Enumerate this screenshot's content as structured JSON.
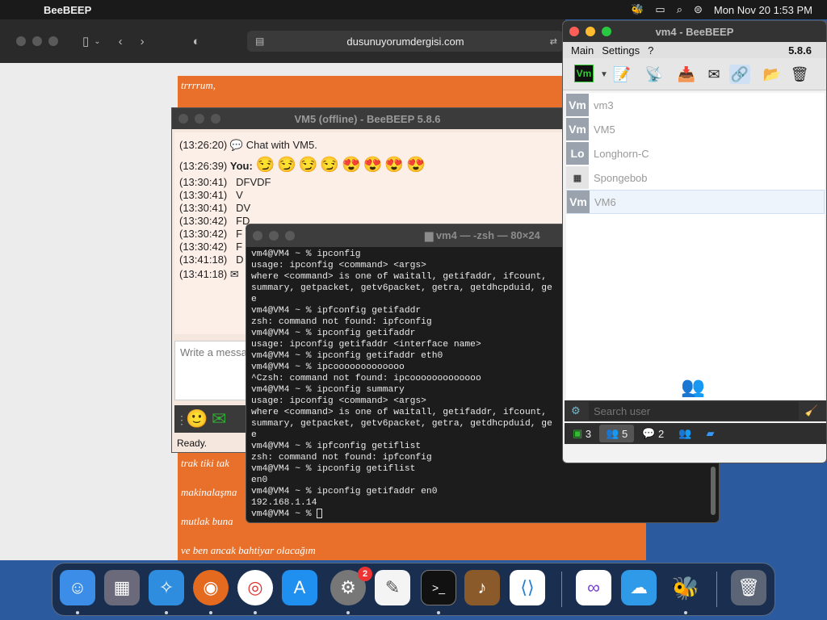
{
  "menubar": {
    "app": "BeeBEEP",
    "datetime": "Mon Nov 20  1:53 PM"
  },
  "safari": {
    "url": "dusunuyorumdergisi.com"
  },
  "article": {
    "lines": [
      "trrrrum,",
      "trak tiki tak",
      "makinalaşma",
      "mutlak buna",
      "ve ben ancak bahtiyar olacağım"
    ]
  },
  "vm5": {
    "title": "VM5 (offline) - BeeBEEP 5.8.6",
    "chat": [
      {
        "time": "(13:26:20)",
        "text": "Chat with VM5."
      },
      {
        "time": "(13:26:39)",
        "text": "You:"
      },
      {
        "time": "(13:30:41)",
        "text": "DFVDF"
      },
      {
        "time": "(13:30:41)",
        "text": "V"
      },
      {
        "time": "(13:30:41)",
        "text": "DV"
      },
      {
        "time": "(13:30:42)",
        "text": "FD"
      },
      {
        "time": "(13:30:42)",
        "text": "F"
      },
      {
        "time": "(13:30:42)",
        "text": "F"
      },
      {
        "time": "(13:41:18)",
        "text": "D"
      },
      {
        "time": "(13:41:18)",
        "text": ""
      }
    ],
    "emojis": "😏😏😏😏😍😍😍😍",
    "input_placeholder": "Write a message",
    "status": "Ready."
  },
  "terminal": {
    "title": "vm4 — -zsh — 80×24",
    "lines": [
      "vm4@VM4 ~ % ipconfig",
      "usage: ipconfig <command> <args>",
      "where <command> is one of waitall, getifaddr, ifcount,",
      "summary, getpacket, getv6packet, getra, getdhcpduid, ge",
      "e",
      "vm4@VM4 ~ % ipfconfig getifaddr",
      "zsh: command not found: ipfconfig",
      "vm4@VM4 ~ % ipconfig getifaddr",
      "usage: ipconfig getifaddr <interface name>",
      "vm4@VM4 ~ % ipconfig getifaddr eth0",
      "vm4@VM4 ~ % ipcooooooooooooo",
      "^Czsh: command not found: ipcooooooooooooo",
      "vm4@VM4 ~ % ipconfig summary",
      "usage: ipconfig <command> <args>",
      "where <command> is one of waitall, getifaddr, ifcount,",
      "summary, getpacket, getv6packet, getra, getdhcpduid, ge",
      "e",
      "vm4@VM4 ~ % ipfconfig getiflist",
      "zsh: command not found: ipfconfig",
      "vm4@VM4 ~ % ipconfig getiflist",
      "en0",
      "vm4@VM4 ~ % ipconfig getifaddr en0",
      "192.168.1.14",
      "vm4@VM4 ~ % "
    ]
  },
  "beebeep": {
    "title": "vm4 - BeeBEEP",
    "menu": [
      "Main",
      "Settings",
      "?"
    ],
    "version": "5.8.6",
    "vm_badge": "Vm",
    "users": [
      {
        "avatar": "Vm",
        "name": "vm3"
      },
      {
        "avatar": "Vm",
        "name": "VM5"
      },
      {
        "avatar": "Lo",
        "name": "Longhorn-C"
      },
      {
        "avatar": "",
        "name": "Spongebob"
      },
      {
        "avatar": "Vm",
        "name": "VM6"
      }
    ],
    "search_placeholder": "Search user",
    "status_counts": [
      "3",
      "5",
      "2"
    ]
  },
  "dock": {
    "settings_badge": "2"
  },
  "colors": {
    "article_orange": "#e8702a",
    "terminal_bg": "#1c1c1c",
    "dock_bg": "#14203a"
  }
}
